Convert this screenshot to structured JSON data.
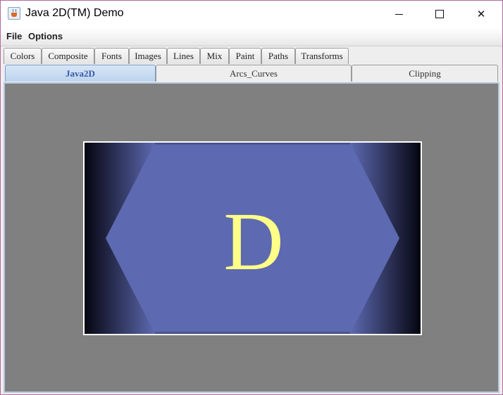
{
  "window": {
    "title": "Java 2D(TM) Demo",
    "icon": "java-cup-icon",
    "controls": [
      "minimize-icon",
      "maximize-icon",
      "close-icon"
    ]
  },
  "menubar": {
    "items": [
      "File",
      "Options"
    ]
  },
  "tabs_primary": [
    "Colors",
    "Composite",
    "Fonts",
    "Images",
    "Lines",
    "Mix",
    "Paint",
    "Paths",
    "Transforms"
  ],
  "tabs_secondary": {
    "items": [
      "Java2D",
      "Arcs_Curves",
      "Clipping"
    ],
    "selected": "Java2D"
  },
  "demo": {
    "letter": "D",
    "colors": {
      "background": "#808080",
      "panel": "#5d69b0",
      "letter": "#ffff88",
      "frame": "#ffffff"
    }
  }
}
